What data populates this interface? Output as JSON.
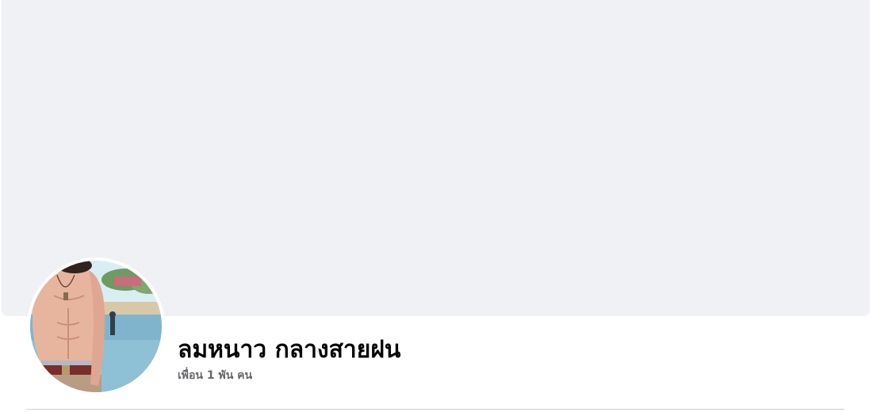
{
  "profile": {
    "name": "ลมหนาว กลางสายฝน",
    "friends_text": "เพื่อน 1 พัน คน"
  },
  "colors": {
    "cover_background": "#f0f1f5",
    "name_text": "#050505",
    "secondary_text": "#65676b",
    "divider": "#ced0d4"
  }
}
